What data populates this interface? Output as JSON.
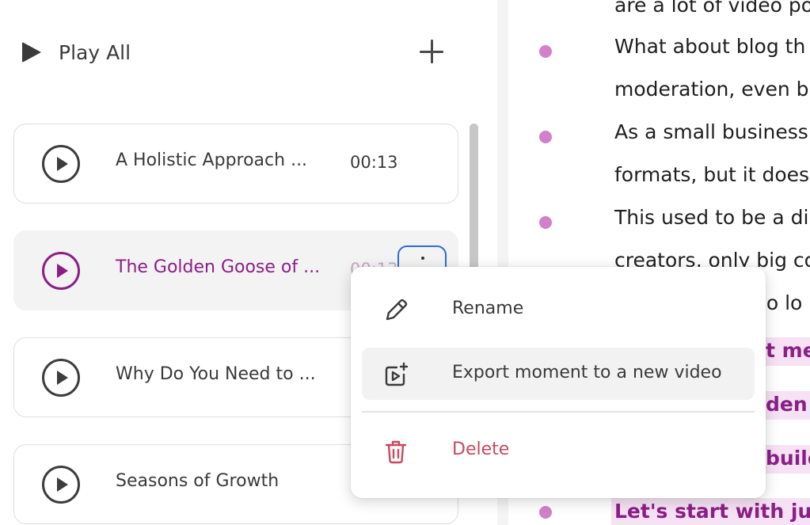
{
  "playlist": {
    "play_all_label": "Play All",
    "add_icon": "plus-icon",
    "items": [
      {
        "title": "A Holistic Approach ...",
        "duration": "00:13"
      },
      {
        "title": "The Golden Goose of ...",
        "duration": "00:13"
      },
      {
        "title": "Why Do You Need to ..."
      },
      {
        "title": "Seasons of Growth"
      }
    ]
  },
  "transcript": {
    "lines": [
      "are a lot of video po",
      "What about blog th",
      "moderation, even b",
      "As a small business",
      "formats, but it does",
      "This used to be a di",
      "creators, only big co",
      "no lo",
      "t me",
      "den g",
      "build",
      "Let's start with jus"
    ]
  },
  "context_menu": {
    "items": [
      {
        "label": "Rename",
        "icon": "pencil-icon"
      },
      {
        "label": "Export moment to a new video",
        "icon": "video-add-icon"
      },
      {
        "label": "Delete",
        "icon": "trash-icon"
      }
    ]
  },
  "colors": {
    "accent": "#8b1f86",
    "highlight_bg": "#f6e2f4",
    "bullet": "#d081c9",
    "danger": "#c9485f",
    "focus": "#2f6bd6"
  }
}
